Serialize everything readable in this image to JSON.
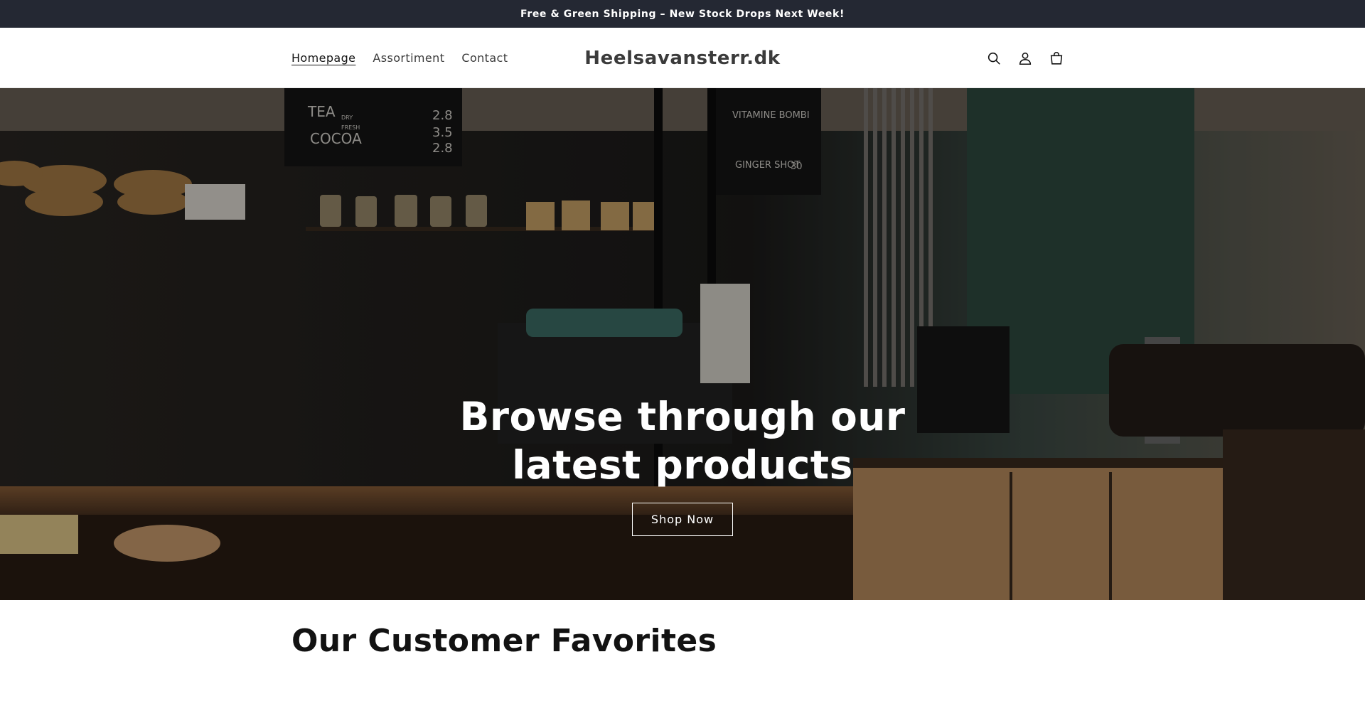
{
  "announcement": {
    "text": "Free & Green Shipping – New Stock Drops Next Week!"
  },
  "header": {
    "nav": [
      {
        "label": "Homepage",
        "active": true
      },
      {
        "label": "Assortiment",
        "active": false
      },
      {
        "label": "Contact",
        "active": false
      }
    ],
    "logo": "Heelsavansterr.dk",
    "icons": [
      "search-icon",
      "account-icon",
      "cart-icon"
    ]
  },
  "hero": {
    "title": "Browse through our latest products",
    "button_label": "Shop Now",
    "menu_board": {
      "tea": "TEA",
      "dry": "DRY",
      "fresh": "FRESH",
      "cocoa": "COCOA",
      "prices": [
        "2.8",
        "3.5",
        "2.8"
      ],
      "vitamine": "VITAMINE BOMBI",
      "ginger": "GINGER SHOT",
      "ginger_price": "30"
    }
  },
  "favorites": {
    "title": "Our Customer Favorites"
  },
  "colors": {
    "announcement_bg": "#242833",
    "text": "#121212",
    "hero_overlay": "rgba(0,0,0,0.35)"
  }
}
